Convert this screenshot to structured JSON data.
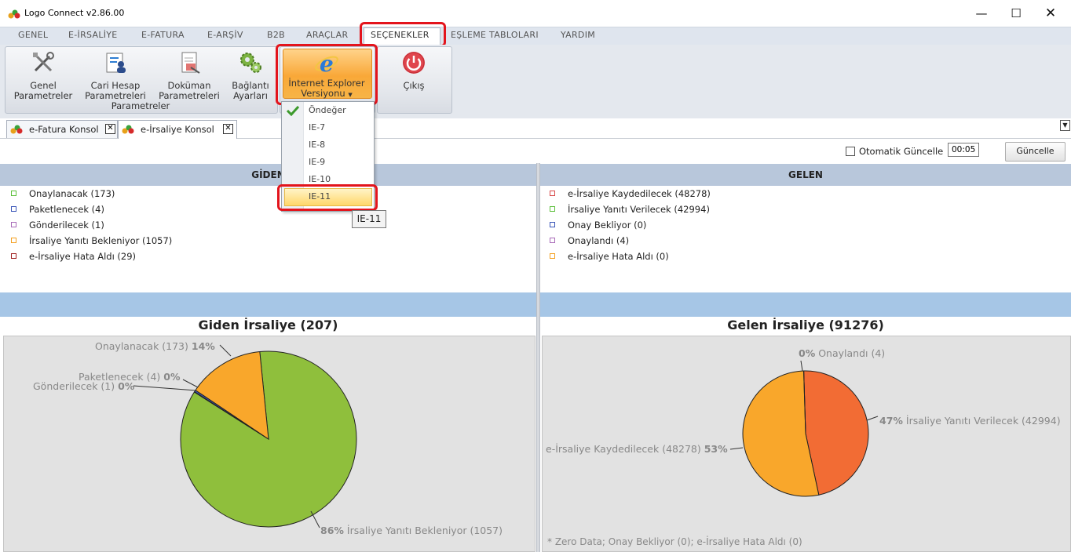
{
  "window": {
    "title": "Logo Connect v2.86.00"
  },
  "menu": {
    "tabs": [
      "GENEL",
      "E-İRSALİYE",
      "E-FATURA",
      "E-ARŞİV",
      "B2B",
      "ARAÇLAR",
      "SEÇENEKLER",
      "EŞLEME TABLOLARI",
      "YARDIM"
    ]
  },
  "ribbon": {
    "buttons": [
      {
        "line1": "Genel",
        "line2": "Parametreler"
      },
      {
        "line1": "Cari Hesap",
        "line2": "Parametreleri"
      },
      {
        "line1": "Doküman",
        "line2": "Parametreleri"
      },
      {
        "line1": "Bağlantı",
        "line2": "Ayarları"
      }
    ],
    "group_label": "Parametreler",
    "ie": {
      "line1": "İnternet Explorer",
      "line2": "Versiyonu"
    },
    "exit": "Çıkış"
  },
  "dropdown": {
    "items": [
      "Öndeğer",
      "IE-7",
      "IE-8",
      "IE-9",
      "IE-10",
      "IE-11"
    ],
    "checked_index": 0,
    "highlighted_index": 5
  },
  "tooltip": "IE-11",
  "doc_tabs": [
    "e-Fatura Konsol",
    "e-İrsaliye Konsol"
  ],
  "toolbar": {
    "auto_update_label": "Otomatik Güncelle",
    "time_value": "00:05",
    "update_button": "Güncelle"
  },
  "left_panel": {
    "header": "GİDEN",
    "legend": [
      {
        "label": "Onaylanacak (173)",
        "color": "#5cbf3a"
      },
      {
        "label": "Paketlenecek (4)",
        "color": "#3a56b8"
      },
      {
        "label": "Gönderilecek (1)",
        "color": "#a86ab8"
      },
      {
        "label": "İrsaliye Yanıtı Bekleniyor (1057)",
        "color": "#f4a020"
      },
      {
        "label": "e-İrsaliye Hata Aldı (29)",
        "color": "#a02020"
      }
    ],
    "chart_title": "Giden İrsaliye (207)"
  },
  "right_panel": {
    "header": "GELEN",
    "legend": [
      {
        "label": "e-İrsaliye Kaydedilecek (48278)",
        "color": "#d84a4a"
      },
      {
        "label": "İrsaliye Yanıtı Verilecek (42994)",
        "color": "#5cbf3a"
      },
      {
        "label": "Onay Bekliyor (0)",
        "color": "#3a56b8"
      },
      {
        "label": "Onaylandı (4)",
        "color": "#a86ab8"
      },
      {
        "label": "e-İrsaliye Hata Aldı (0)",
        "color": "#f4a020"
      }
    ],
    "chart_title": "Gelen İrsaliye (91276)",
    "footnote": "* Zero Data; Onay Bekliyor (0); e-İrsaliye Hata Aldı (0)"
  },
  "chart_data": [
    {
      "type": "pie",
      "title": "Giden İrsaliye (207)",
      "slices": [
        {
          "label": "İrsaliye Yanıtı Bekleniyor (1057)",
          "value": 1057,
          "percent": "86%",
          "color": "#8fbf3c"
        },
        {
          "label": "Onaylanacak (173)",
          "value": 173,
          "percent": "14%",
          "color": "#f9a72b"
        },
        {
          "label": "Paketlenecek (4)",
          "value": 4,
          "percent": "0%",
          "color": "#3a56b8"
        },
        {
          "label": "Gönderilecek (1)",
          "value": 1,
          "percent": "0%",
          "color": "#a86ab8"
        }
      ]
    },
    {
      "type": "pie",
      "title": "Gelen İrsaliye (91276)",
      "slices": [
        {
          "label": "İrsaliye Yanıtı Verilecek (42994)",
          "value": 42994,
          "percent": "47%",
          "color": "#f26c34"
        },
        {
          "label": "e-İrsaliye Kaydedilecek (48278)",
          "value": 48278,
          "percent": "53%",
          "color": "#f9a72b"
        },
        {
          "label": "Onaylandı (4)",
          "value": 4,
          "percent": "0%",
          "color": "#a86ab8"
        }
      ]
    }
  ]
}
